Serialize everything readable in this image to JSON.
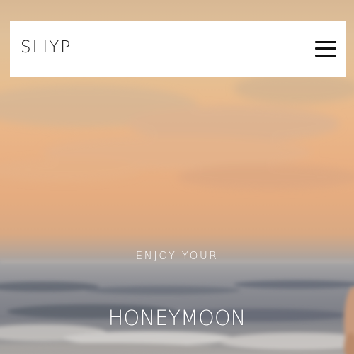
{
  "header": {
    "brand": "SLIYP",
    "menu_icon": "hamburger-menu-icon"
  },
  "hero": {
    "eyebrow": "ENJOY YOUR",
    "headline": "HONEYMOON",
    "background_image": "sunset-sea-photo"
  },
  "colors": {
    "header_bg": "#ffffff",
    "brand_text": "#1c1c1c",
    "hero_text": "#ffffff"
  }
}
